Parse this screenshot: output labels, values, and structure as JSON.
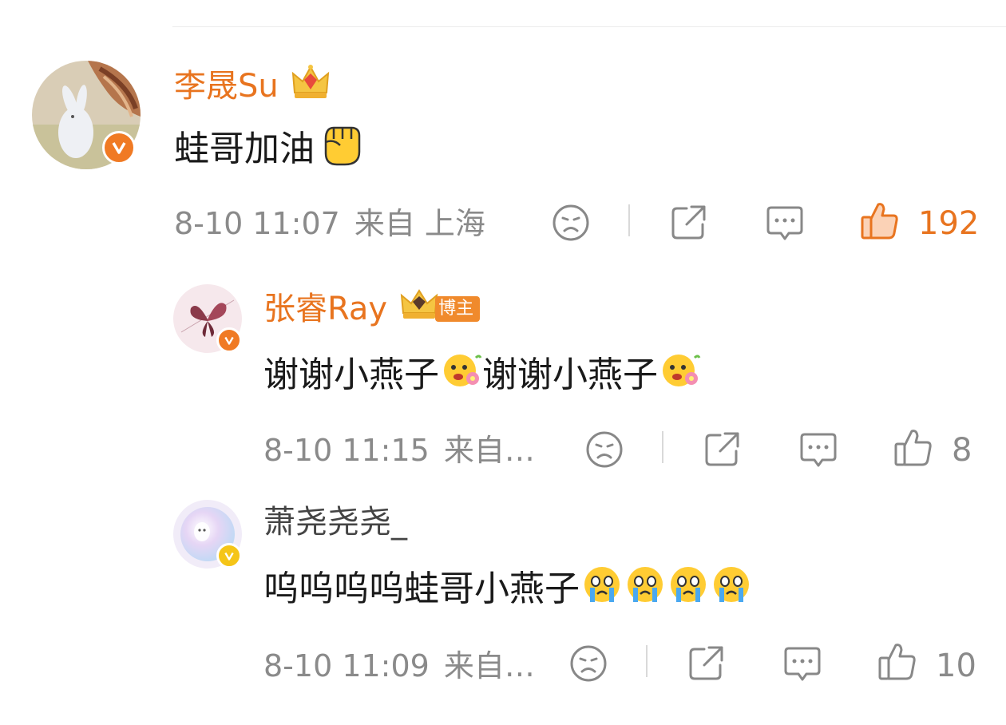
{
  "comments": [
    {
      "username": "李晟Su",
      "text": "蛙哥加油",
      "text_emojis": [
        "fist-emoji"
      ],
      "time": "8-10 11:07",
      "location": "来自 上海",
      "likes": "192",
      "liked": true,
      "verified_color": "#f07a24"
    },
    {
      "username": "张睿Ray",
      "tag": "博主",
      "text_part1": "谢谢小燕子",
      "text_part2": "谢谢小燕子",
      "time": "8-10 11:15",
      "location": "来自…",
      "likes": "8",
      "liked": false,
      "verified_color": "#f07a24"
    },
    {
      "username": "萧尧尧尧_",
      "text": "呜呜呜呜蛙哥小燕子",
      "time": "8-10 11:09",
      "location": "来自…",
      "likes": "10",
      "liked": false,
      "verified_color": "#f5c518"
    }
  ],
  "colors": {
    "accent": "#e8741f",
    "meta": "#8a8a8a",
    "divider": "#ececec"
  }
}
